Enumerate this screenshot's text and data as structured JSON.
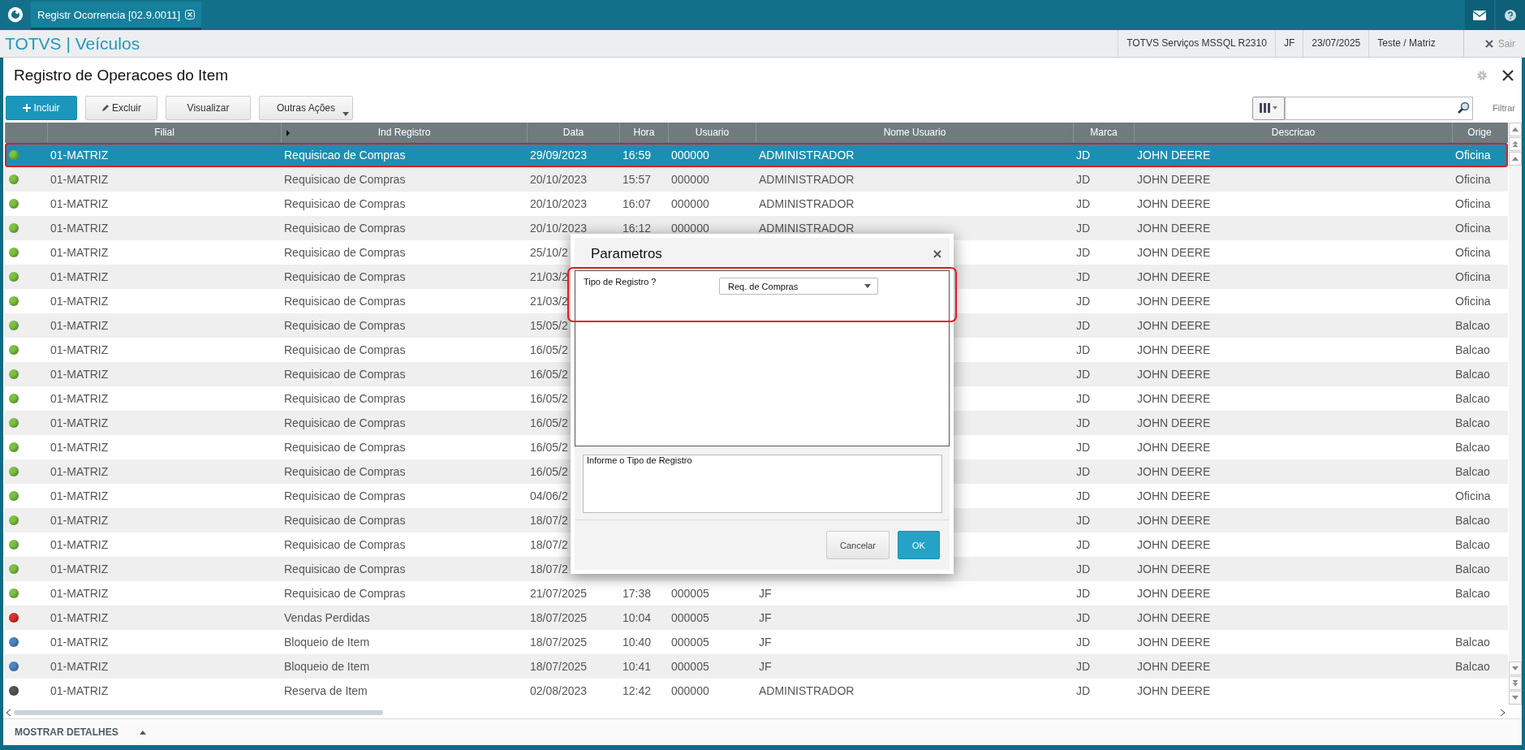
{
  "app_bar": {
    "tab": {
      "title": "Registr Ocorrencia [02.9.0011]",
      "selected": true
    }
  },
  "header": {
    "brand": "TOTVS | Veículos",
    "info": [
      "TOTVS Serviços MSSQL R2310",
      "JF",
      "23/07/2025",
      "Teste / Matriz"
    ],
    "exit": "Sair"
  },
  "page": {
    "title": "Registro de Operacoes do Item"
  },
  "toolbar": {
    "buttons": [
      {
        "label": "Incluir",
        "kind": "primary"
      },
      {
        "label": "Excluir",
        "kind": "edit"
      },
      {
        "label": "Visualizar",
        "kind": "plain"
      },
      {
        "label": "Outras Ações",
        "kind": "menu"
      }
    ],
    "filter_label": "Filtrar"
  },
  "table": {
    "columns": [
      "Filial",
      "Ind Registro",
      "Data",
      "Hora",
      "Usuario",
      "Nome Usuario",
      "Marca",
      "Descricao",
      "Orige"
    ],
    "rows": [
      {
        "color": "#7cc242",
        "selected": true,
        "highlighted": true,
        "filial": "01-MATRIZ",
        "ind_registro": "Requisicao de Compras",
        "data": "29/09/2023",
        "hora": "16:59",
        "usuario": "000000",
        "nome_usuario": "ADMINISTRADOR",
        "marca": "JD",
        "descricao": "JOHN DEERE",
        "origem": "Oficina"
      },
      {
        "color": "#7cc242",
        "selected": false,
        "highlighted": false,
        "filial": "01-MATRIZ",
        "ind_registro": "Requisicao de Compras",
        "data": "20/10/2023",
        "hora": "15:57",
        "usuario": "000000",
        "nome_usuario": "ADMINISTRADOR",
        "marca": "JD",
        "descricao": "JOHN DEERE",
        "origem": "Oficina"
      },
      {
        "color": "#7cc242",
        "selected": false,
        "highlighted": false,
        "filial": "01-MATRIZ",
        "ind_registro": "Requisicao de Compras",
        "data": "20/10/2023",
        "hora": "16:07",
        "usuario": "000000",
        "nome_usuario": "ADMINISTRADOR",
        "marca": "JD",
        "descricao": "JOHN DEERE",
        "origem": "Oficina"
      },
      {
        "color": "#7cc242",
        "selected": false,
        "highlighted": false,
        "filial": "01-MATRIZ",
        "ind_registro": "Requisicao de Compras",
        "data": "20/10/2023",
        "hora": "16:12",
        "usuario": "000000",
        "nome_usuario": "ADMINISTRADOR",
        "marca": "JD",
        "descricao": "JOHN DEERE",
        "origem": "Oficina"
      },
      {
        "color": "#7cc242",
        "selected": false,
        "highlighted": false,
        "filial": "01-MATRIZ",
        "ind_registro": "Requisicao de Compras",
        "data": "25/10/2",
        "marca": "JD",
        "descricao": "JOHN DEERE",
        "origem": "Oficina"
      },
      {
        "color": "#7cc242",
        "selected": false,
        "highlighted": false,
        "filial": "01-MATRIZ",
        "ind_registro": "Requisicao de Compras",
        "data": "21/03/2",
        "marca": "JD",
        "descricao": "JOHN DEERE",
        "origem": "Oficina"
      },
      {
        "color": "#7cc242",
        "selected": false,
        "highlighted": false,
        "filial": "01-MATRIZ",
        "ind_registro": "Requisicao de Compras",
        "data": "21/03/2",
        "marca": "JD",
        "descricao": "JOHN DEERE",
        "origem": "Oficina"
      },
      {
        "color": "#7cc242",
        "selected": false,
        "highlighted": false,
        "filial": "01-MATRIZ",
        "ind_registro": "Requisicao de Compras",
        "data": "15/05/2",
        "marca": "JD",
        "descricao": "JOHN DEERE",
        "origem": "Balcao"
      },
      {
        "color": "#7cc242",
        "selected": false,
        "highlighted": false,
        "filial": "01-MATRIZ",
        "ind_registro": "Requisicao de Compras",
        "data": "16/05/2",
        "marca": "JD",
        "descricao": "JOHN DEERE",
        "origem": "Balcao"
      },
      {
        "color": "#7cc242",
        "selected": false,
        "highlighted": false,
        "filial": "01-MATRIZ",
        "ind_registro": "Requisicao de Compras",
        "data": "16/05/2",
        "marca": "JD",
        "descricao": "JOHN DEERE",
        "origem": "Balcao"
      },
      {
        "color": "#7cc242",
        "selected": false,
        "highlighted": false,
        "filial": "01-MATRIZ",
        "ind_registro": "Requisicao de Compras",
        "data": "16/05/2",
        "marca": "JD",
        "descricao": "JOHN DEERE",
        "origem": "Balcao"
      },
      {
        "color": "#7cc242",
        "selected": false,
        "highlighted": false,
        "filial": "01-MATRIZ",
        "ind_registro": "Requisicao de Compras",
        "data": "16/05/2",
        "marca": "JD",
        "descricao": "JOHN DEERE",
        "origem": "Balcao"
      },
      {
        "color": "#7cc242",
        "selected": false,
        "highlighted": false,
        "filial": "01-MATRIZ",
        "ind_registro": "Requisicao de Compras",
        "data": "16/05/2",
        "marca": "JD",
        "descricao": "JOHN DEERE",
        "origem": "Balcao"
      },
      {
        "color": "#7cc242",
        "selected": false,
        "highlighted": false,
        "filial": "01-MATRIZ",
        "ind_registro": "Requisicao de Compras",
        "data": "16/05/2",
        "marca": "JD",
        "descricao": "JOHN DEERE",
        "origem": "Balcao"
      },
      {
        "color": "#7cc242",
        "selected": false,
        "highlighted": false,
        "filial": "01-MATRIZ",
        "ind_registro": "Requisicao de Compras",
        "data": "04/06/2",
        "marca": "JD",
        "descricao": "JOHN DEERE",
        "origem": "Oficina"
      },
      {
        "color": "#7cc242",
        "selected": false,
        "highlighted": false,
        "filial": "01-MATRIZ",
        "ind_registro": "Requisicao de Compras",
        "data": "18/07/2",
        "marca": "JD",
        "descricao": "JOHN DEERE",
        "origem": "Balcao"
      },
      {
        "color": "#7cc242",
        "selected": false,
        "highlighted": false,
        "filial": "01-MATRIZ",
        "ind_registro": "Requisicao de Compras",
        "data": "18/07/2",
        "marca": "JD",
        "descricao": "JOHN DEERE",
        "origem": "Balcao"
      },
      {
        "color": "#7cc242",
        "selected": false,
        "highlighted": false,
        "filial": "01-MATRIZ",
        "ind_registro": "Requisicao de Compras",
        "data": "18/07/2",
        "marca": "JD",
        "descricao": "JOHN DEERE",
        "origem": "Balcao"
      },
      {
        "color": "#7cc242",
        "selected": false,
        "highlighted": false,
        "filial": "01-MATRIZ",
        "ind_registro": "Requisicao de Compras",
        "data": "21/07/2025",
        "hora": "17:38",
        "usuario": "000005",
        "nome_usuario": "JF",
        "marca": "JD",
        "descricao": "JOHN DEERE",
        "origem": "Balcao"
      },
      {
        "color": "#d9302c",
        "selected": false,
        "highlighted": false,
        "filial": "01-MATRIZ",
        "ind_registro": "Vendas Perdidas",
        "data": "18/07/2025",
        "hora": "10:04",
        "usuario": "000005",
        "nome_usuario": "JF",
        "marca": "JD",
        "descricao": "JOHN DEERE"
      },
      {
        "color": "#4a86c5",
        "selected": false,
        "highlighted": false,
        "filial": "01-MATRIZ",
        "ind_registro": "Bloqueio de Item",
        "data": "18/07/2025",
        "hora": "10:40",
        "usuario": "000005",
        "nome_usuario": "JF",
        "marca": "JD",
        "descricao": "JOHN DEERE",
        "origem": "Balcao"
      },
      {
        "color": "#4a86c5",
        "selected": false,
        "highlighted": false,
        "filial": "01-MATRIZ",
        "ind_registro": "Bloqueio de Item",
        "data": "18/07/2025",
        "hora": "10:41",
        "usuario": "000005",
        "nome_usuario": "JF",
        "marca": "JD",
        "descricao": "JOHN DEERE",
        "origem": "Balcao"
      },
      {
        "color": "#555555",
        "selected": false,
        "highlighted": false,
        "filial": "01-MATRIZ",
        "ind_registro": "Reserva de Item",
        "data": "02/08/2023",
        "hora": "12:42",
        "usuario": "000000",
        "nome_usuario": "ADMINISTRADOR",
        "marca": "JD",
        "descricao": "JOHN DEERE"
      }
    ]
  },
  "footer": {
    "details": "MOSTRAR DETALHES"
  },
  "dialog": {
    "title": "Parametros",
    "field": {
      "label": "Tipo de Registro ?",
      "value": "Req. de Compras",
      "highlighted": true
    },
    "help": "Informe o Tipo de Registro",
    "buttons": [
      {
        "label": "Cancelar",
        "kind": "secondary"
      },
      {
        "label": "OK",
        "kind": "primary"
      }
    ]
  }
}
